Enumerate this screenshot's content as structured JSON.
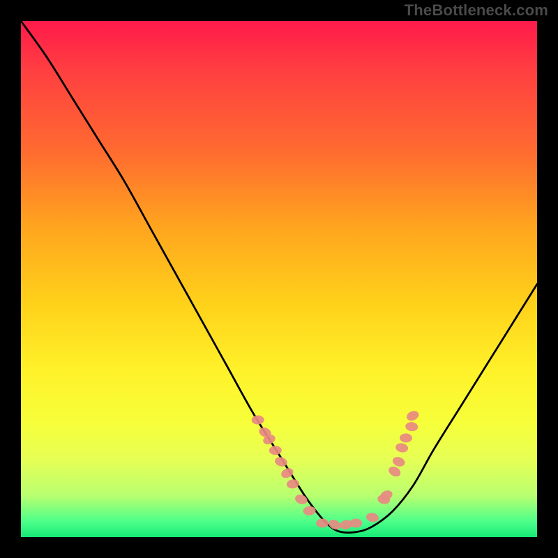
{
  "watermark": "TheBottleneck.com",
  "colors": {
    "page_bg": "#000000",
    "curve": "#000000",
    "marker_fill": "#e88a82",
    "marker_stroke": "#c94f46",
    "gradient_stops": [
      "#ff1a4b",
      "#ff4040",
      "#ff6a30",
      "#ffa51e",
      "#ffd21a",
      "#fff22a",
      "#f6ff3a",
      "#e6ff55",
      "#b8ff70",
      "#4dff8a",
      "#17e876"
    ]
  },
  "chart_data": {
    "type": "line",
    "title": "",
    "xlabel": "",
    "ylabel": "",
    "xlim": [
      0,
      100
    ],
    "ylim": [
      0,
      100
    ],
    "grid": false,
    "legend": false,
    "series": [
      {
        "name": "bottleneck-curve",
        "x": [
          0,
          5,
          10,
          15,
          20,
          25,
          30,
          35,
          40,
          45,
          50,
          55,
          58,
          60,
          62,
          65,
          68,
          72,
          76,
          80,
          85,
          90,
          95,
          100
        ],
        "y": [
          100,
          93,
          85,
          77,
          69,
          60,
          51,
          42,
          33,
          24,
          16,
          8,
          4,
          2,
          1,
          1,
          2,
          5,
          10,
          17,
          25,
          33,
          41,
          49
        ]
      }
    ],
    "markers": [
      {
        "x": 45.9,
        "y": 22.7
      },
      {
        "x": 47.3,
        "y": 20.3
      },
      {
        "x": 48.1,
        "y": 18.9
      },
      {
        "x": 49.3,
        "y": 16.8
      },
      {
        "x": 50.4,
        "y": 14.6
      },
      {
        "x": 51.6,
        "y": 12.4
      },
      {
        "x": 52.7,
        "y": 10.3
      },
      {
        "x": 54.3,
        "y": 7.3
      },
      {
        "x": 55.9,
        "y": 5.1
      },
      {
        "x": 58.4,
        "y": 2.7
      },
      {
        "x": 60.8,
        "y": 2.4
      },
      {
        "x": 63.0,
        "y": 2.4
      },
      {
        "x": 64.9,
        "y": 2.7
      },
      {
        "x": 68.1,
        "y": 3.8
      },
      {
        "x": 70.3,
        "y": 7.3
      },
      {
        "x": 70.8,
        "y": 8.1
      },
      {
        "x": 72.4,
        "y": 12.7
      },
      {
        "x": 73.2,
        "y": 14.6
      },
      {
        "x": 73.8,
        "y": 17.3
      },
      {
        "x": 74.6,
        "y": 19.2
      },
      {
        "x": 75.7,
        "y": 21.4
      },
      {
        "x": 75.9,
        "y": 23.5
      }
    ]
  }
}
